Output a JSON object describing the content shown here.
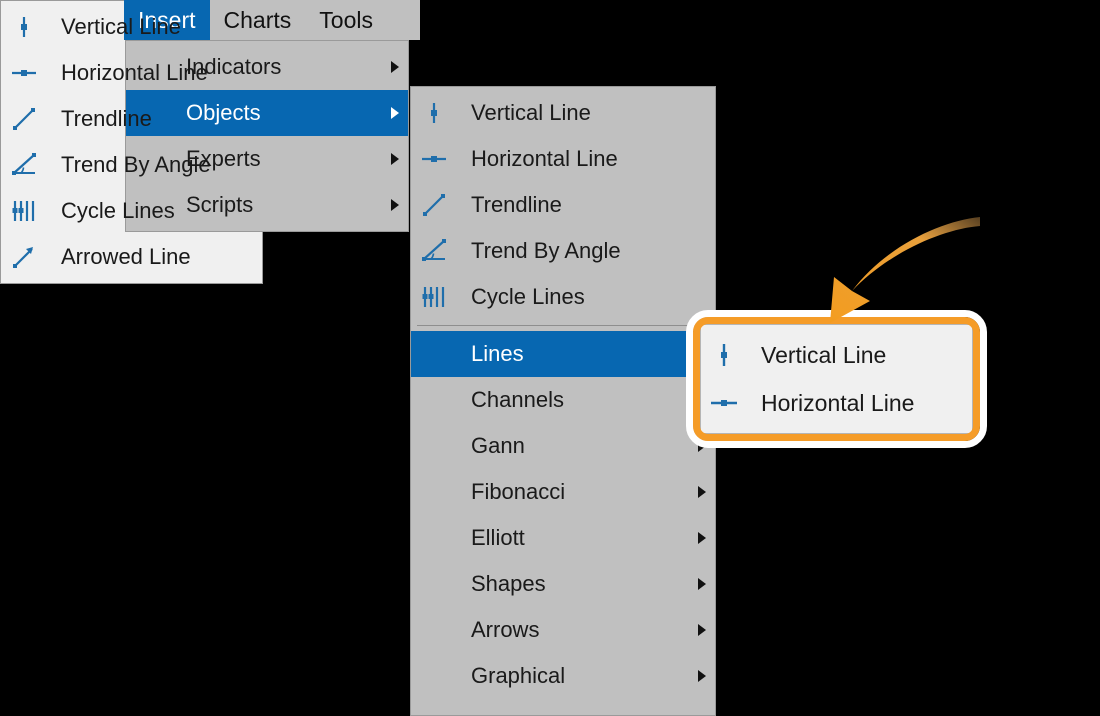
{
  "app": {
    "accent_blue": "#0767b1",
    "menu_bg": "#c0c0c0",
    "submenu_bg": "#f0f0f0",
    "highlight_orange": "#f59c28",
    "icon_blue": "#1f6eab"
  },
  "menubar": {
    "items": [
      {
        "label": "Insert",
        "active": true
      },
      {
        "label": "Charts",
        "active": false
      },
      {
        "label": "Tools",
        "active": false
      }
    ]
  },
  "menu1": {
    "name": "insert-menu",
    "items": [
      {
        "label": "Indicators",
        "arrow": true,
        "selected": false
      },
      {
        "label": "Objects",
        "arrow": true,
        "selected": true
      },
      {
        "label": "Experts",
        "arrow": true,
        "selected": false
      },
      {
        "label": "Scripts",
        "arrow": true,
        "selected": false
      }
    ]
  },
  "menu2": {
    "name": "objects-menu",
    "items": [
      {
        "label": "Vertical Line",
        "icon": "vertical-line-icon",
        "arrow": false,
        "selected": false
      },
      {
        "label": "Horizontal Line",
        "icon": "horizontal-line-icon",
        "arrow": false,
        "selected": false
      },
      {
        "label": "Trendline",
        "icon": "trendline-icon",
        "arrow": false,
        "selected": false
      },
      {
        "label": "Trend By Angle",
        "icon": "trend-by-angle-icon",
        "arrow": false,
        "selected": false
      },
      {
        "label": "Cycle Lines",
        "icon": "cycle-lines-icon",
        "arrow": false,
        "selected": false
      },
      {
        "separator": true
      },
      {
        "label": "Lines",
        "icon": null,
        "arrow": false,
        "selected": true
      },
      {
        "label": "Channels",
        "icon": null,
        "arrow": false,
        "selected": false
      },
      {
        "label": "Gann",
        "icon": null,
        "arrow": true,
        "selected": false
      },
      {
        "label": "Fibonacci",
        "icon": null,
        "arrow": true,
        "selected": false
      },
      {
        "label": "Elliott",
        "icon": null,
        "arrow": true,
        "selected": false
      },
      {
        "label": "Shapes",
        "icon": null,
        "arrow": true,
        "selected": false
      },
      {
        "label": "Arrows",
        "icon": null,
        "arrow": true,
        "selected": false
      },
      {
        "label": "Graphical",
        "icon": null,
        "arrow": true,
        "selected": false
      }
    ]
  },
  "menu3": {
    "name": "lines-submenu",
    "items": [
      {
        "label": "Vertical Line",
        "icon": "vertical-line-icon",
        "highlighted": true
      },
      {
        "label": "Horizontal Line",
        "icon": "horizontal-line-icon",
        "highlighted": true
      },
      {
        "label": "Trendline",
        "icon": "trendline-icon",
        "highlighted": false
      },
      {
        "label": "Trend By Angle",
        "icon": "trend-by-angle-icon",
        "highlighted": false
      },
      {
        "label": "Cycle Lines",
        "icon": "cycle-lines-icon",
        "highlighted": false
      },
      {
        "label": "Arrowed Line",
        "icon": "arrowed-line-icon",
        "highlighted": false
      }
    ]
  },
  "annotation": {
    "highlight": {
      "name": "callout-highlight-box",
      "items": [
        {
          "label": "Vertical Line",
          "icon": "vertical-line-icon"
        },
        {
          "label": "Horizontal Line",
          "icon": "horizontal-line-icon"
        }
      ]
    },
    "arrow": {
      "name": "curved-arrow-annotation",
      "color": "#f5a63a"
    }
  }
}
